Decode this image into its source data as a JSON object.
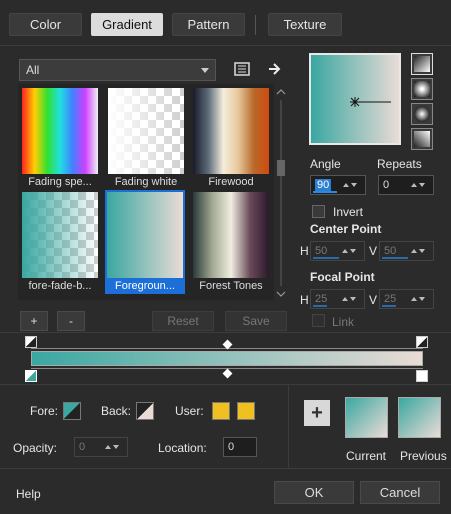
{
  "tabs": [
    {
      "label": "Color",
      "active": false
    },
    {
      "label": "Gradient",
      "active": true
    },
    {
      "label": "Pattern",
      "active": false
    },
    {
      "label": "Texture",
      "active": false
    }
  ],
  "category_dropdown": {
    "value": "All"
  },
  "gallery": {
    "items": [
      {
        "label": "Fading spe..."
      },
      {
        "label": "Fading white"
      },
      {
        "label": "Firewood"
      },
      {
        "label": "fore-fade-b..."
      },
      {
        "label": "Foregroun...",
        "selected": true
      },
      {
        "label": "Forest Tones"
      }
    ]
  },
  "gallery_buttons": {
    "add": "+",
    "remove": "-",
    "reset": "Reset",
    "save": "Save"
  },
  "angle": {
    "label": "Angle",
    "value": "90"
  },
  "repeats": {
    "label": "Repeats",
    "value": "0"
  },
  "invert": {
    "label": "Invert",
    "checked": false
  },
  "center_point": {
    "label": "Center Point",
    "h_label": "H",
    "h_value": "50",
    "v_label": "V",
    "v_value": "50"
  },
  "focal_point": {
    "label": "Focal Point",
    "h_label": "H",
    "h_value": "25",
    "v_label": "V",
    "v_value": "25"
  },
  "link": {
    "label": "Link",
    "checked": false
  },
  "colors": {
    "gradient_start": "#3aa7a1",
    "gradient_end": "#eadbd6",
    "accent": "#1d6fd8",
    "user_swatch": "#f0c020"
  },
  "bottom": {
    "fore_label": "Fore:",
    "back_label": "Back:",
    "user_label": "User:",
    "opacity_label": "Opacity:",
    "opacity_value": "0",
    "location_label": "Location:",
    "location_value": "0",
    "current_label": "Current",
    "previous_label": "Previous"
  },
  "footer": {
    "help": "Help",
    "ok": "OK",
    "cancel": "Cancel"
  }
}
